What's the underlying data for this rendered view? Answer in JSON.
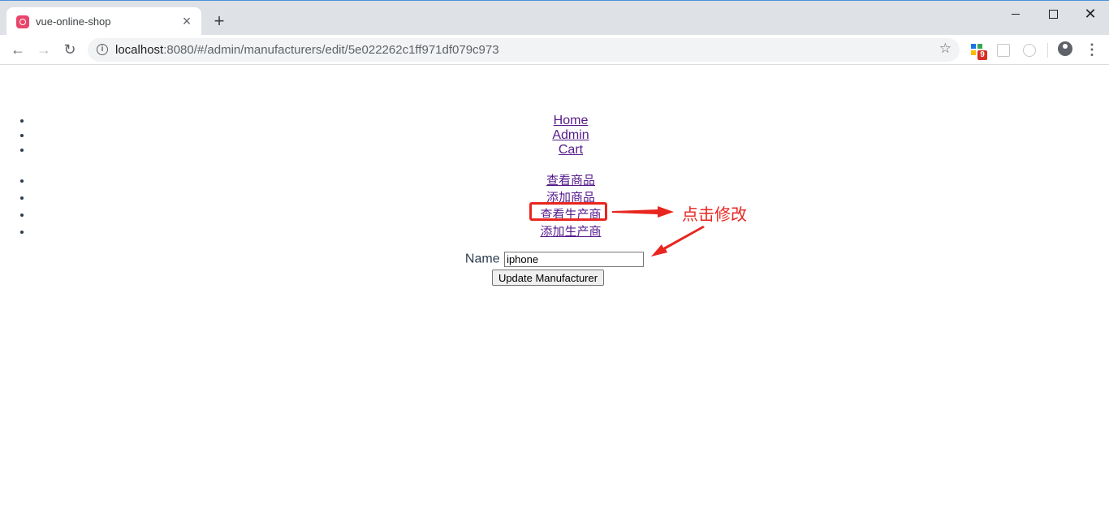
{
  "browser": {
    "tab_title": "vue-online-shop",
    "url_host": "localhost",
    "url_rest": ":8080/#/admin/manufacturers/edit/5e022262c1ff971df079c973",
    "extension_badge": "9",
    "icons": [
      "favicon-icon",
      "close-icon",
      "plus-icon",
      "back-icon",
      "forward-icon",
      "reload-icon",
      "info-icon",
      "star-icon",
      "extension-icon",
      "profile-icon",
      "menu-icon"
    ]
  },
  "main_nav": {
    "items": [
      {
        "label": "Home"
      },
      {
        "label": "Admin"
      },
      {
        "label": "Cart"
      }
    ]
  },
  "admin_nav": {
    "items": [
      {
        "label": "查看商品"
      },
      {
        "label": "添加商品"
      },
      {
        "label": "查看生产商"
      },
      {
        "label": "添加生产商"
      }
    ]
  },
  "form": {
    "name_label": "Name",
    "name_value": "iphone",
    "submit_label": "Update Manufacturer"
  },
  "annotation": {
    "text": "点击修改",
    "color": "#e8261f"
  }
}
